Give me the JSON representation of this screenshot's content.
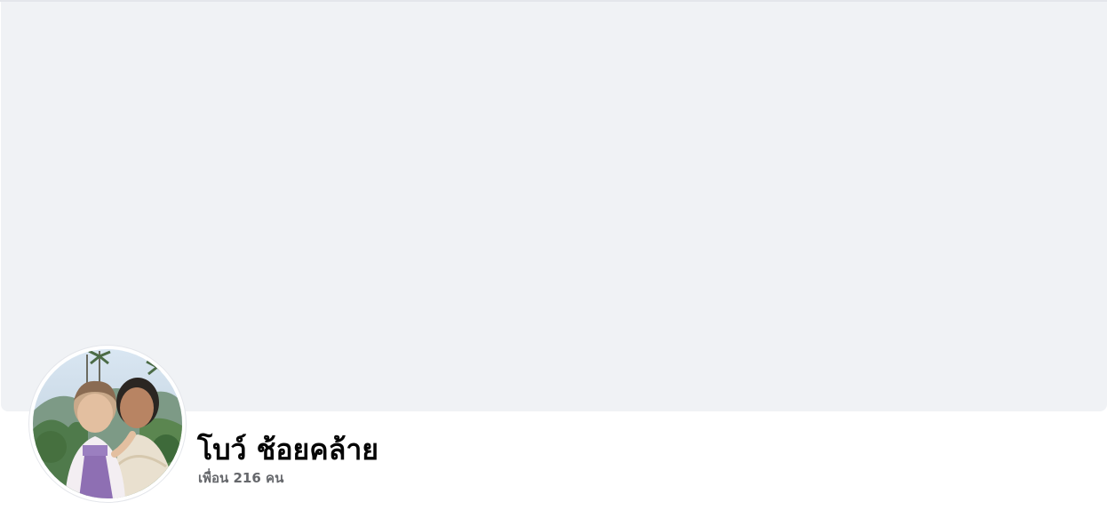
{
  "profile": {
    "name": "โบว์ ช้อยคล้าย",
    "friends_text": "เพื่อน 216 คน",
    "avatar_icon": "profile-photo"
  },
  "colors": {
    "cover": "#f0f2f5",
    "name": "#050505",
    "secondary_text": "#65676b",
    "background": "#ffffff"
  }
}
